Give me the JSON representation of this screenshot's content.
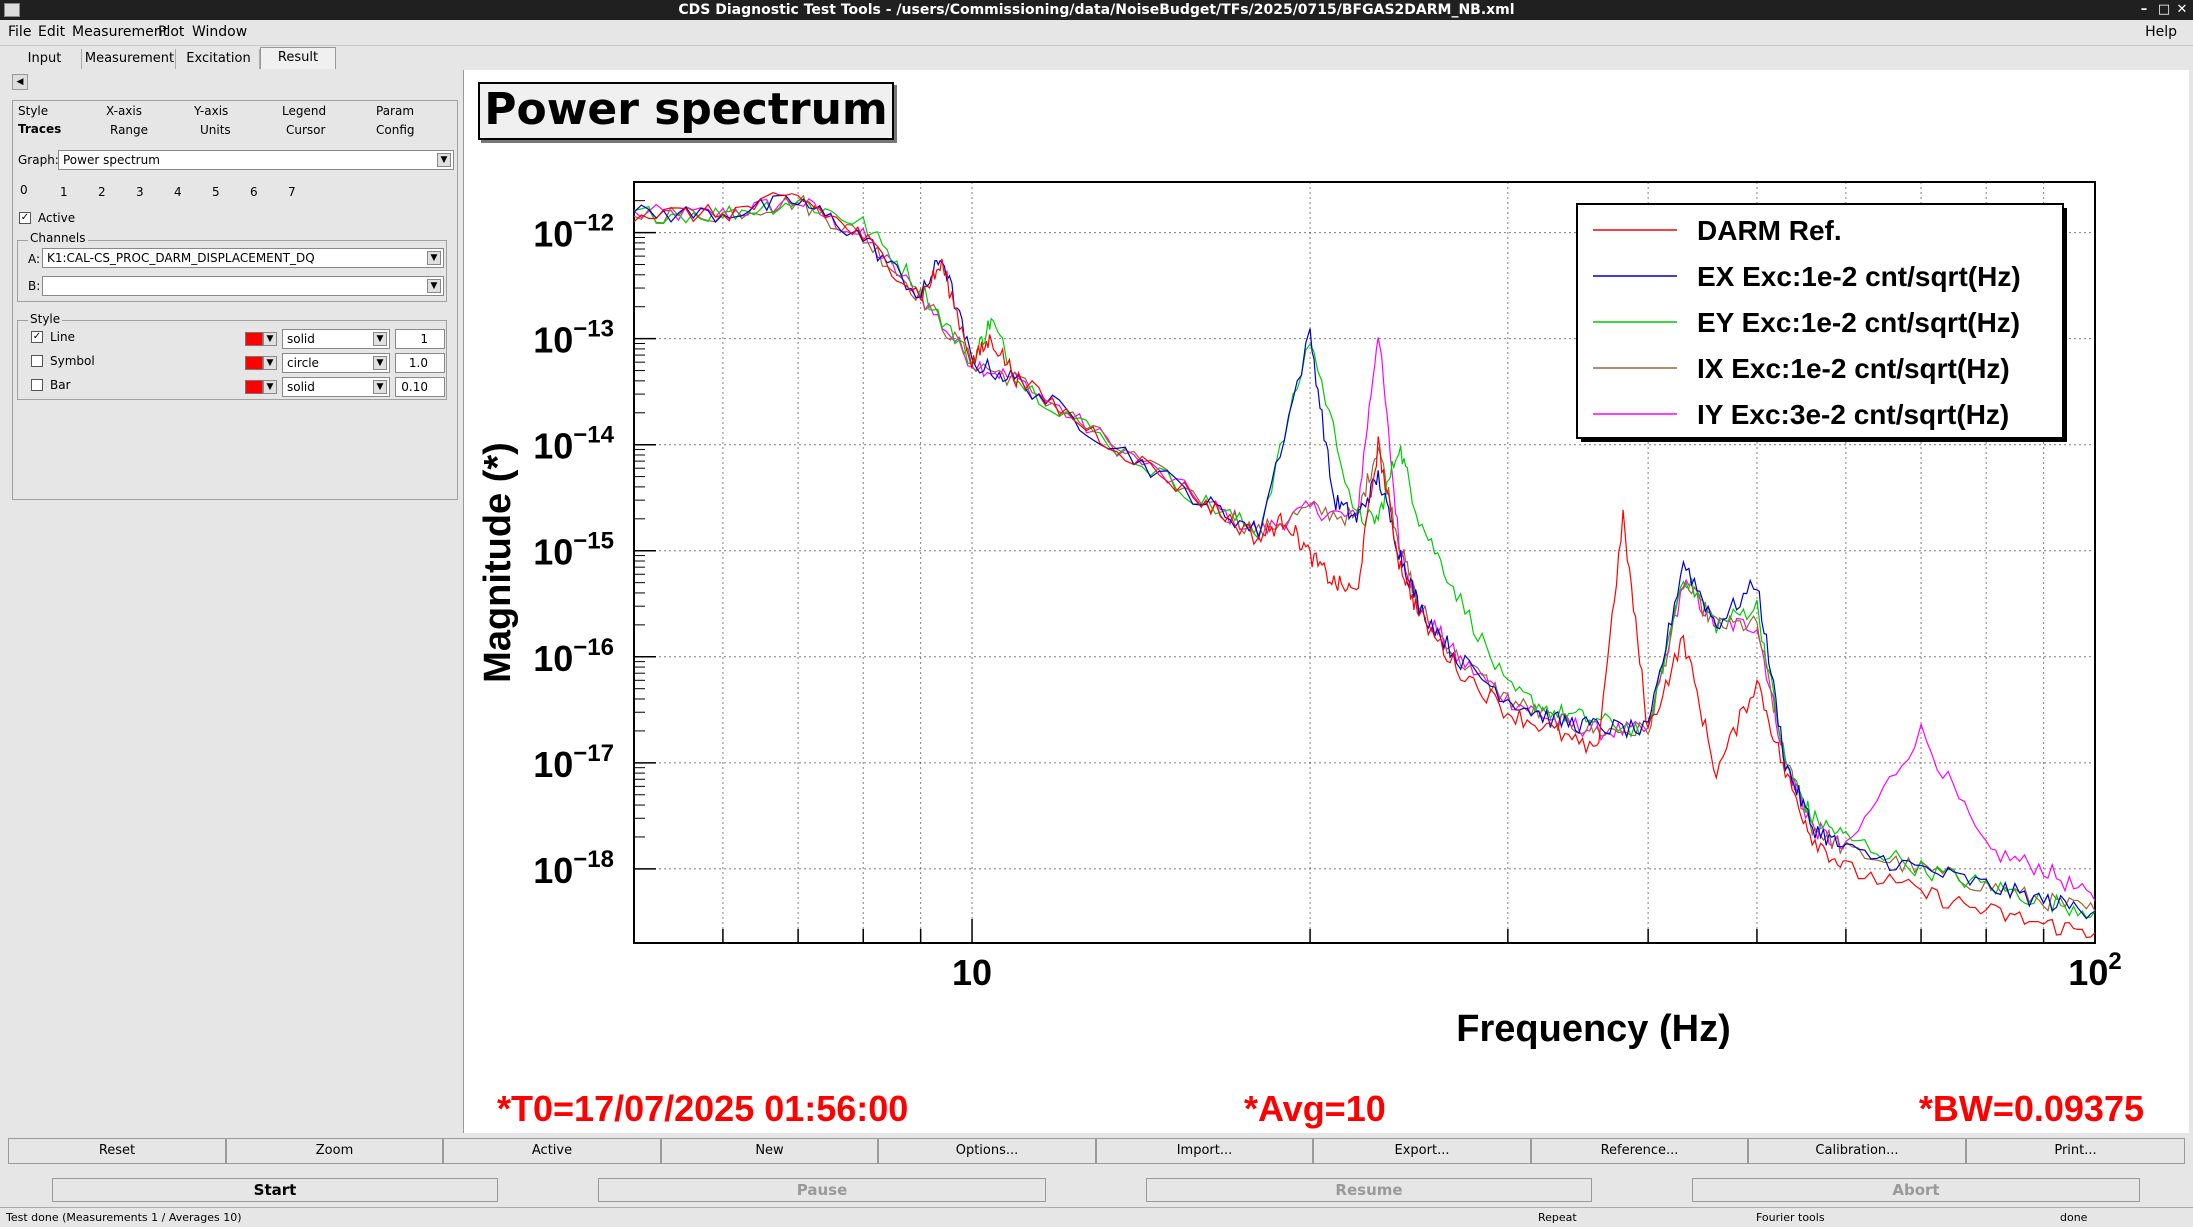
{
  "window": {
    "title": "CDS Diagnostic Test Tools - /users/Commissioning/data/NoiseBudget/TFs/2025/0715/BFGAS2DARM_NB.xml"
  },
  "menu": {
    "file": "File",
    "edit": "Edit",
    "measurement": "Measurement",
    "plot": "Plot",
    "window": "Window",
    "help": "Help"
  },
  "tabs": [
    "Input",
    "Measurement",
    "Excitation",
    "Result"
  ],
  "left": {
    "subtabs_row1": [
      "Style",
      "X-axis",
      "Y-axis",
      "Legend",
      "Param"
    ],
    "subtabs_row2": [
      "Traces",
      "Range",
      "Units",
      "Cursor",
      "Config"
    ],
    "graph_label": "Graph:",
    "graph_value": "Power spectrum",
    "trace_tabs": [
      "0",
      "1",
      "2",
      "3",
      "4",
      "5",
      "6",
      "7"
    ],
    "active_label": "Active",
    "channels_label": "Channels",
    "channel_a_label": "A:",
    "channel_a_value": "K1:CAL-CS_PROC_DARM_DISPLACEMENT_DQ",
    "channel_b_label": "B:",
    "channel_b_value": "",
    "style_label": "Style",
    "line_label": "Line",
    "symbol_label": "Symbol",
    "bar_label": "Bar",
    "line_style": "solid",
    "symbol_style": "circle",
    "bar_style": "solid",
    "line_width": "1",
    "symbol_size": "1.0",
    "bar_width": "0.10",
    "trace_color": "#ff0000"
  },
  "plot": {
    "title": "Power spectrum",
    "xlabel": "Frequency (Hz)",
    "ylabel": "Magnitude (*)",
    "xtick_10": "10",
    "xtick_100_base": "10",
    "xtick_100_exp": "2",
    "ytick_base": "10",
    "ytick_exps": [
      "−12",
      "−13",
      "−14",
      "−15",
      "−16",
      "−17",
      "−18"
    ],
    "t0": "*T0=17/07/2025 01:56:00",
    "avg": "*Avg=10",
    "bw": "*BW=0.09375"
  },
  "chart_data": {
    "type": "line",
    "title": "Power spectrum",
    "xlabel": "Frequency (Hz)",
    "ylabel": "Magnitude (*)",
    "xscale": "log",
    "yscale": "log",
    "xlim": [
      5,
      100
    ],
    "ylim": [
      2e-19,
      3e-12
    ],
    "grid": true,
    "legend_position": "top-right",
    "series": [
      {
        "name": "DARM Ref.",
        "color": "#ff0000",
        "x": [
          5,
          6,
          7,
          8,
          9,
          9.4,
          10,
          10.4,
          11,
          13,
          16,
          18,
          19,
          20,
          21,
          22,
          23,
          24,
          25,
          27,
          30,
          33,
          36,
          38,
          40,
          43,
          46,
          50,
          53,
          56,
          60,
          70,
          80,
          90,
          100
        ],
        "y": [
          1.5e-12,
          1.5e-12,
          2.2e-12,
          9e-13,
          2.5e-13,
          5e-13,
          6e-14,
          1e-13,
          4e-14,
          1.2e-14,
          3e-15,
          1.3e-15,
          2e-15,
          9e-16,
          5e-16,
          4e-16,
          1e-14,
          8e-16,
          2.5e-16,
          8e-17,
          3e-17,
          2e-17,
          1.2e-17,
          2e-15,
          2e-17,
          1.5e-16,
          8e-18,
          6e-17,
          8e-18,
          2e-18,
          1e-18,
          6e-19,
          4e-19,
          3e-19,
          2.5e-19
        ]
      },
      {
        "name": "EX Exc:1e-2 cnt/sqrt(Hz)",
        "color": "#0000cc",
        "x": [
          5,
          6,
          7,
          8,
          9,
          9.4,
          10,
          11,
          13,
          16,
          18,
          20,
          21,
          22,
          23,
          24,
          25,
          27,
          30,
          33,
          36,
          40,
          43,
          46,
          50,
          53,
          56,
          60,
          70,
          80,
          90,
          100
        ],
        "y": [
          1.5e-12,
          1.5e-12,
          2e-12,
          9e-13,
          2.5e-13,
          6e-13,
          6e-14,
          4e-14,
          1.2e-14,
          3e-15,
          1.5e-15,
          1.1e-13,
          3e-15,
          2e-15,
          5e-15,
          1e-15,
          3e-16,
          1e-16,
          4e-17,
          2.5e-17,
          2.2e-17,
          2e-17,
          8e-16,
          2e-16,
          5e-16,
          1e-17,
          2.5e-18,
          1.5e-18,
          1e-18,
          7e-19,
          5e-19,
          4e-19
        ]
      },
      {
        "name": "EY Exc:1e-2 cnt/sqrt(Hz)",
        "color": "#00cc00",
        "x": [
          5,
          6,
          7,
          8,
          9,
          10,
          10.4,
          11,
          13,
          16,
          18,
          20,
          22,
          23,
          24,
          25,
          27,
          30,
          33,
          36,
          40,
          43,
          46,
          50,
          53,
          56,
          60,
          70,
          80,
          90,
          100
        ],
        "y": [
          1.5e-12,
          1.5e-12,
          2e-12,
          1.2e-12,
          3e-13,
          6e-14,
          1.5e-13,
          4e-14,
          1.2e-14,
          3e-15,
          1.5e-15,
          1e-13,
          2e-15,
          2e-15,
          1e-14,
          2e-15,
          4e-16,
          5e-17,
          3e-17,
          2.5e-17,
          2e-17,
          6e-16,
          2e-16,
          3e-16,
          1e-17,
          3e-18,
          2e-18,
          1e-18,
          7e-19,
          5e-19,
          4e-19
        ]
      },
      {
        "name": "IX Exc:1e-2 cnt/sqrt(Hz)",
        "color": "#996633",
        "x": [
          5,
          6,
          7,
          8,
          9,
          10,
          11,
          13,
          16,
          18,
          20,
          22,
          23,
          24,
          25,
          27,
          30,
          33,
          36,
          40,
          43,
          46,
          50,
          53,
          56,
          60,
          70,
          80,
          90,
          100
        ],
        "y": [
          1.5e-12,
          1.5e-12,
          2e-12,
          9e-13,
          2.5e-13,
          6e-14,
          4e-14,
          1.2e-14,
          3e-15,
          1.5e-15,
          2.5e-15,
          2e-15,
          1e-14,
          1.2e-15,
          3e-16,
          1e-16,
          4e-17,
          2.5e-17,
          2e-17,
          2e-17,
          5e-16,
          2e-16,
          2e-16,
          1e-17,
          2.5e-18,
          1.5e-18,
          1e-18,
          7e-19,
          5e-19,
          4e-19
        ]
      },
      {
        "name": "IY Exc:3e-2 cnt/sqrt(Hz)",
        "color": "#ff00ff",
        "x": [
          5,
          6,
          7,
          8,
          9,
          10,
          11,
          13,
          16,
          18,
          20,
          22,
          23,
          24,
          25,
          27,
          30,
          33,
          36,
          40,
          43,
          46,
          50,
          53,
          56,
          60,
          70,
          80,
          90,
          100
        ],
        "y": [
          1.5e-12,
          1.5e-12,
          2e-12,
          9e-13,
          2.5e-13,
          6e-14,
          4e-14,
          1.2e-14,
          3e-15,
          1.5e-15,
          2.5e-15,
          2e-15,
          1.2e-13,
          1.2e-15,
          3e-16,
          1e-16,
          4e-17,
          2.5e-17,
          2e-17,
          2e-17,
          5e-16,
          2e-16,
          2e-16,
          1e-17,
          2.5e-18,
          1.5e-18,
          2e-17,
          1.5e-18,
          1e-18,
          5e-19
        ]
      }
    ]
  },
  "buttons": [
    "Reset",
    "Zoom",
    "Active",
    "New",
    "Options...",
    "Import...",
    "Export...",
    "Reference...",
    "Calibration...",
    "Print..."
  ],
  "controls": {
    "start": "Start",
    "pause": "Pause",
    "resume": "Resume",
    "abort": "Abort"
  },
  "status": {
    "message": "Test done (Measurements 1 / Averages 10)",
    "repeat": "Repeat",
    "fourier": "Fourier tools",
    "done": "done"
  }
}
